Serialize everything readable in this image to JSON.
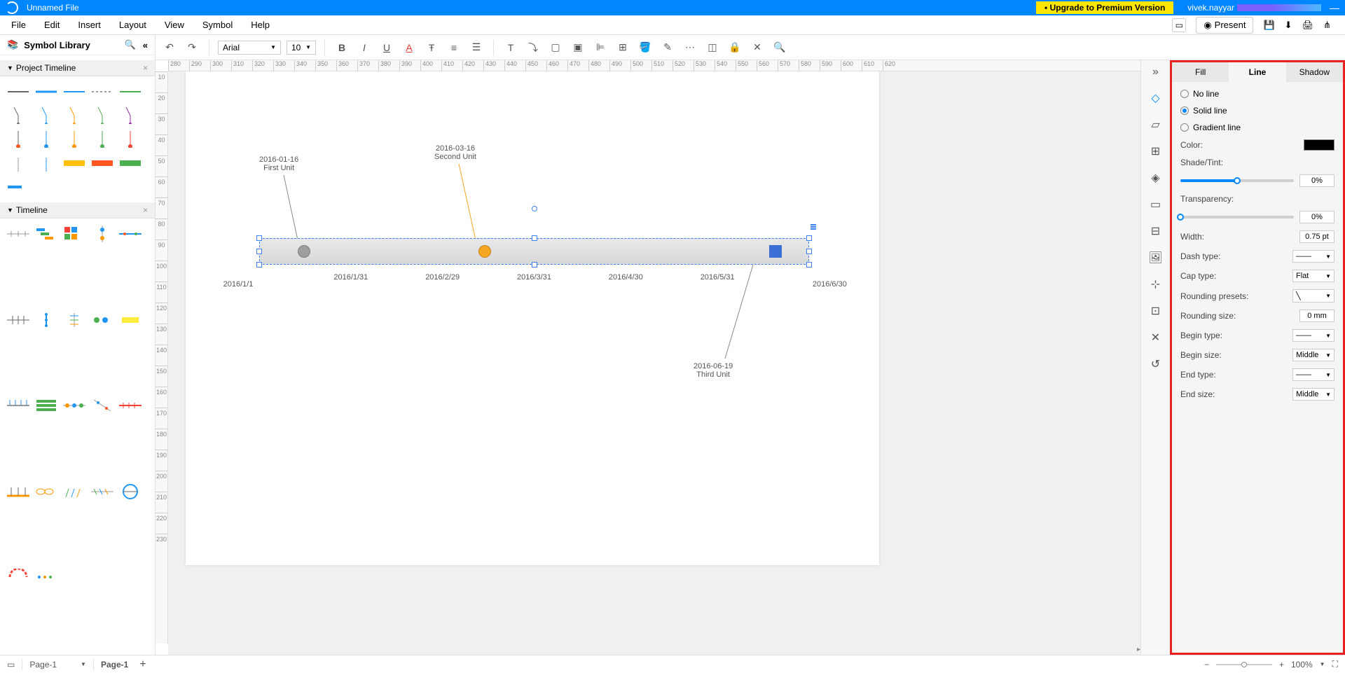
{
  "titlebar": {
    "filename": "Unnamed File",
    "upgrade": "• Upgrade to Premium Version",
    "username": "vivek.nayyar"
  },
  "menu": {
    "file": "File",
    "edit": "Edit",
    "insert": "Insert",
    "layout": "Layout",
    "view": "View",
    "symbol": "Symbol",
    "help": "Help",
    "present": "Present"
  },
  "toolbar": {
    "font": "Arial",
    "size": "10"
  },
  "symbol_library": {
    "title": "Symbol Library",
    "sections": {
      "project_timeline": "Project Timeline",
      "timeline": "Timeline"
    }
  },
  "rulers": {
    "h": [
      "280",
      "290",
      "300",
      "310",
      "320",
      "330",
      "340",
      "350",
      "360",
      "370",
      "380",
      "390",
      "400",
      "410",
      "420",
      "430",
      "440",
      "450",
      "460",
      "470",
      "480",
      "490",
      "500",
      "510",
      "520",
      "530",
      "540",
      "550",
      "560",
      "570",
      "580",
      "590",
      "600",
      "610",
      "620"
    ],
    "v": [
      "10",
      "20",
      "30",
      "40",
      "50",
      "60",
      "70",
      "80",
      "90",
      "100",
      "110",
      "120",
      "130",
      "140",
      "150",
      "160",
      "170",
      "180",
      "190",
      "200",
      "210",
      "220",
      "230"
    ]
  },
  "chart_data": {
    "type": "timeline",
    "range": [
      "2016/1/1",
      "2016/6/30"
    ],
    "axis_ticks": [
      "2016/1/1",
      "2016/1/31",
      "2016/2/29",
      "2016/3/31",
      "2016/4/30",
      "2016/5/31",
      "2016/6/30"
    ],
    "events": [
      {
        "date": "2016-01-16",
        "label": "First Unit",
        "pos_pct": 8,
        "color": "#9e9e9e",
        "shape": "circle",
        "label_side": "top"
      },
      {
        "date": "2016-03-16",
        "label": "Second Unit",
        "pos_pct": 41,
        "color": "#f5a623",
        "shape": "circle",
        "label_side": "top"
      },
      {
        "date": "2016-06-19",
        "label": "Third Unit",
        "pos_pct": 94,
        "color": "#3b6fd6",
        "shape": "square",
        "label_side": "bottom"
      }
    ]
  },
  "right_panel": {
    "tabs": {
      "fill": "Fill",
      "line": "Line",
      "shadow": "Shadow"
    },
    "line_types": {
      "none": "No line",
      "solid": "Solid line",
      "gradient": "Gradient line"
    },
    "selected_type": "solid",
    "color_label": "Color:",
    "color": "#000000",
    "shade_label": "Shade/Tint:",
    "shade_value": "0%",
    "shade_pct": 50,
    "transparency_label": "Transparency:",
    "transparency_value": "0%",
    "transparency_pct": 0,
    "width_label": "Width:",
    "width_value": "0.75 pt",
    "dash_label": "Dash type:",
    "cap_label": "Cap type:",
    "cap_value": "Flat",
    "round_preset_label": "Rounding presets:",
    "round_size_label": "Rounding size:",
    "round_size_value": "0 mm",
    "begin_type_label": "Begin type:",
    "begin_size_label": "Begin size:",
    "begin_size_value": "Middle",
    "end_type_label": "End type:",
    "end_size_label": "End size:",
    "end_size_value": "Middle"
  },
  "bottombar": {
    "page_select": "Page-1",
    "page_tab": "Page-1",
    "zoom": "100%"
  }
}
